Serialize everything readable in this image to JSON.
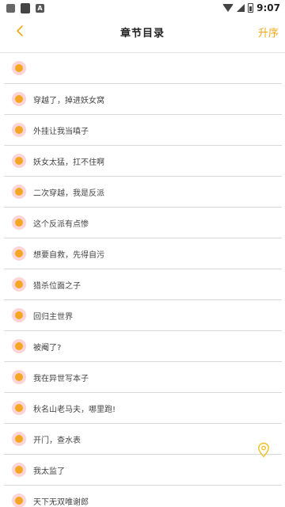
{
  "status_bar": {
    "time": "9:07",
    "icons": [
      "image-icon",
      "sd-card-icon",
      "a-badge-icon",
      "wifi-icon",
      "signal-icon",
      "battery-icon"
    ]
  },
  "header": {
    "title": "章节目录",
    "sort_label": "升序",
    "back_icon": "chevron-left-icon"
  },
  "colors": {
    "accent": "#f5a623",
    "dot_ring": "#fbd5d8",
    "divider": "#d8d8d8"
  },
  "chapters": [
    {
      "title": ""
    },
    {
      "title": "穿越了，掉进妖女窝"
    },
    {
      "title": "外挂让我当嗔子"
    },
    {
      "title": "妖女太猛，扛不住啊"
    },
    {
      "title": "二次穿越，我是反派"
    },
    {
      "title": "这个反派有点惨"
    },
    {
      "title": "想要自救，先得自污"
    },
    {
      "title": "猎杀位面之子"
    },
    {
      "title": "回归主世界"
    },
    {
      "title": "被阉了?"
    },
    {
      "title": "我在异世写本子"
    },
    {
      "title": "秋名山老马夫，哪里跑!"
    },
    {
      "title": "开门，查水表"
    },
    {
      "title": "我太监了"
    },
    {
      "title": "天下无双唯谢郎"
    }
  ],
  "floating": {
    "location_icon": "location-pin-icon"
  }
}
